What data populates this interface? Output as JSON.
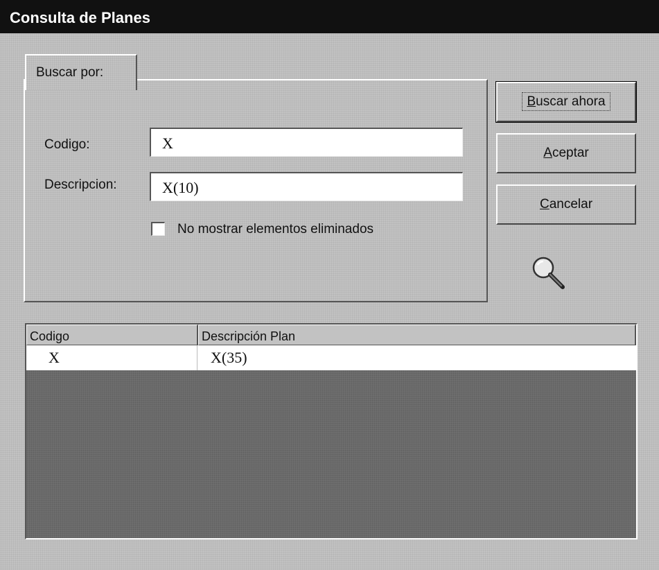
{
  "window": {
    "title": "Consulta de Planes"
  },
  "tab": {
    "label": "Buscar por:"
  },
  "form": {
    "codigo_label": "Codigo:",
    "codigo_value": "X",
    "descripcion_label": "Descripcion:",
    "descripcion_value": "X(10)",
    "checkbox_label": "No mostrar elementos eliminados",
    "checkbox_checked": false
  },
  "buttons": {
    "buscar": {
      "accel": "B",
      "rest": "uscar ahora"
    },
    "aceptar": {
      "accel": "A",
      "rest": "ceptar"
    },
    "cancelar": {
      "accel": "C",
      "rest": "ancelar"
    }
  },
  "icons": {
    "search": "magnifier-icon"
  },
  "table": {
    "columns": [
      "Codigo",
      "Descripción Plan"
    ],
    "rows": [
      [
        "X",
        "X(35)"
      ]
    ]
  }
}
